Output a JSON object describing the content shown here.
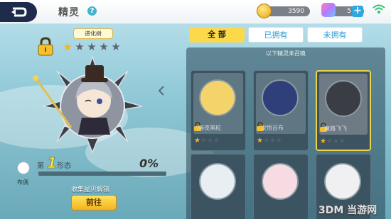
{
  "header": {
    "title": "精灵",
    "help_icon": "question-icon",
    "coins": "3590",
    "gems": "5",
    "plus_label": "+"
  },
  "left": {
    "evolution_tree_label": "进化树",
    "form_prefix": "第",
    "form_number": "1",
    "form_suffix": "形态",
    "progress_percent": "0%",
    "progress_value": 0,
    "avatar_label": "布偶",
    "unlock_hint": "收集星贝解锁",
    "goto_label": "前往",
    "star_rating": 1,
    "star_max": 5
  },
  "tabs": [
    {
      "label": "全 部",
      "active": true
    },
    {
      "label": "已拥有",
      "active": false
    },
    {
      "label": "未拥有",
      "active": false
    }
  ],
  "grid": {
    "notice": "以下精灵未召唤",
    "cards": [
      {
        "name": "暗夜黑粒",
        "stars": 1
      },
      {
        "name": "次悟吕布",
        "stars": 1
      },
      {
        "name": "魔路飞飞",
        "stars": 1
      }
    ]
  },
  "watermark": "3DM 当游网",
  "colors": {
    "accent": "#fbd94a",
    "tab_text": "#2d9bd8",
    "topbar": "#ffffff"
  }
}
